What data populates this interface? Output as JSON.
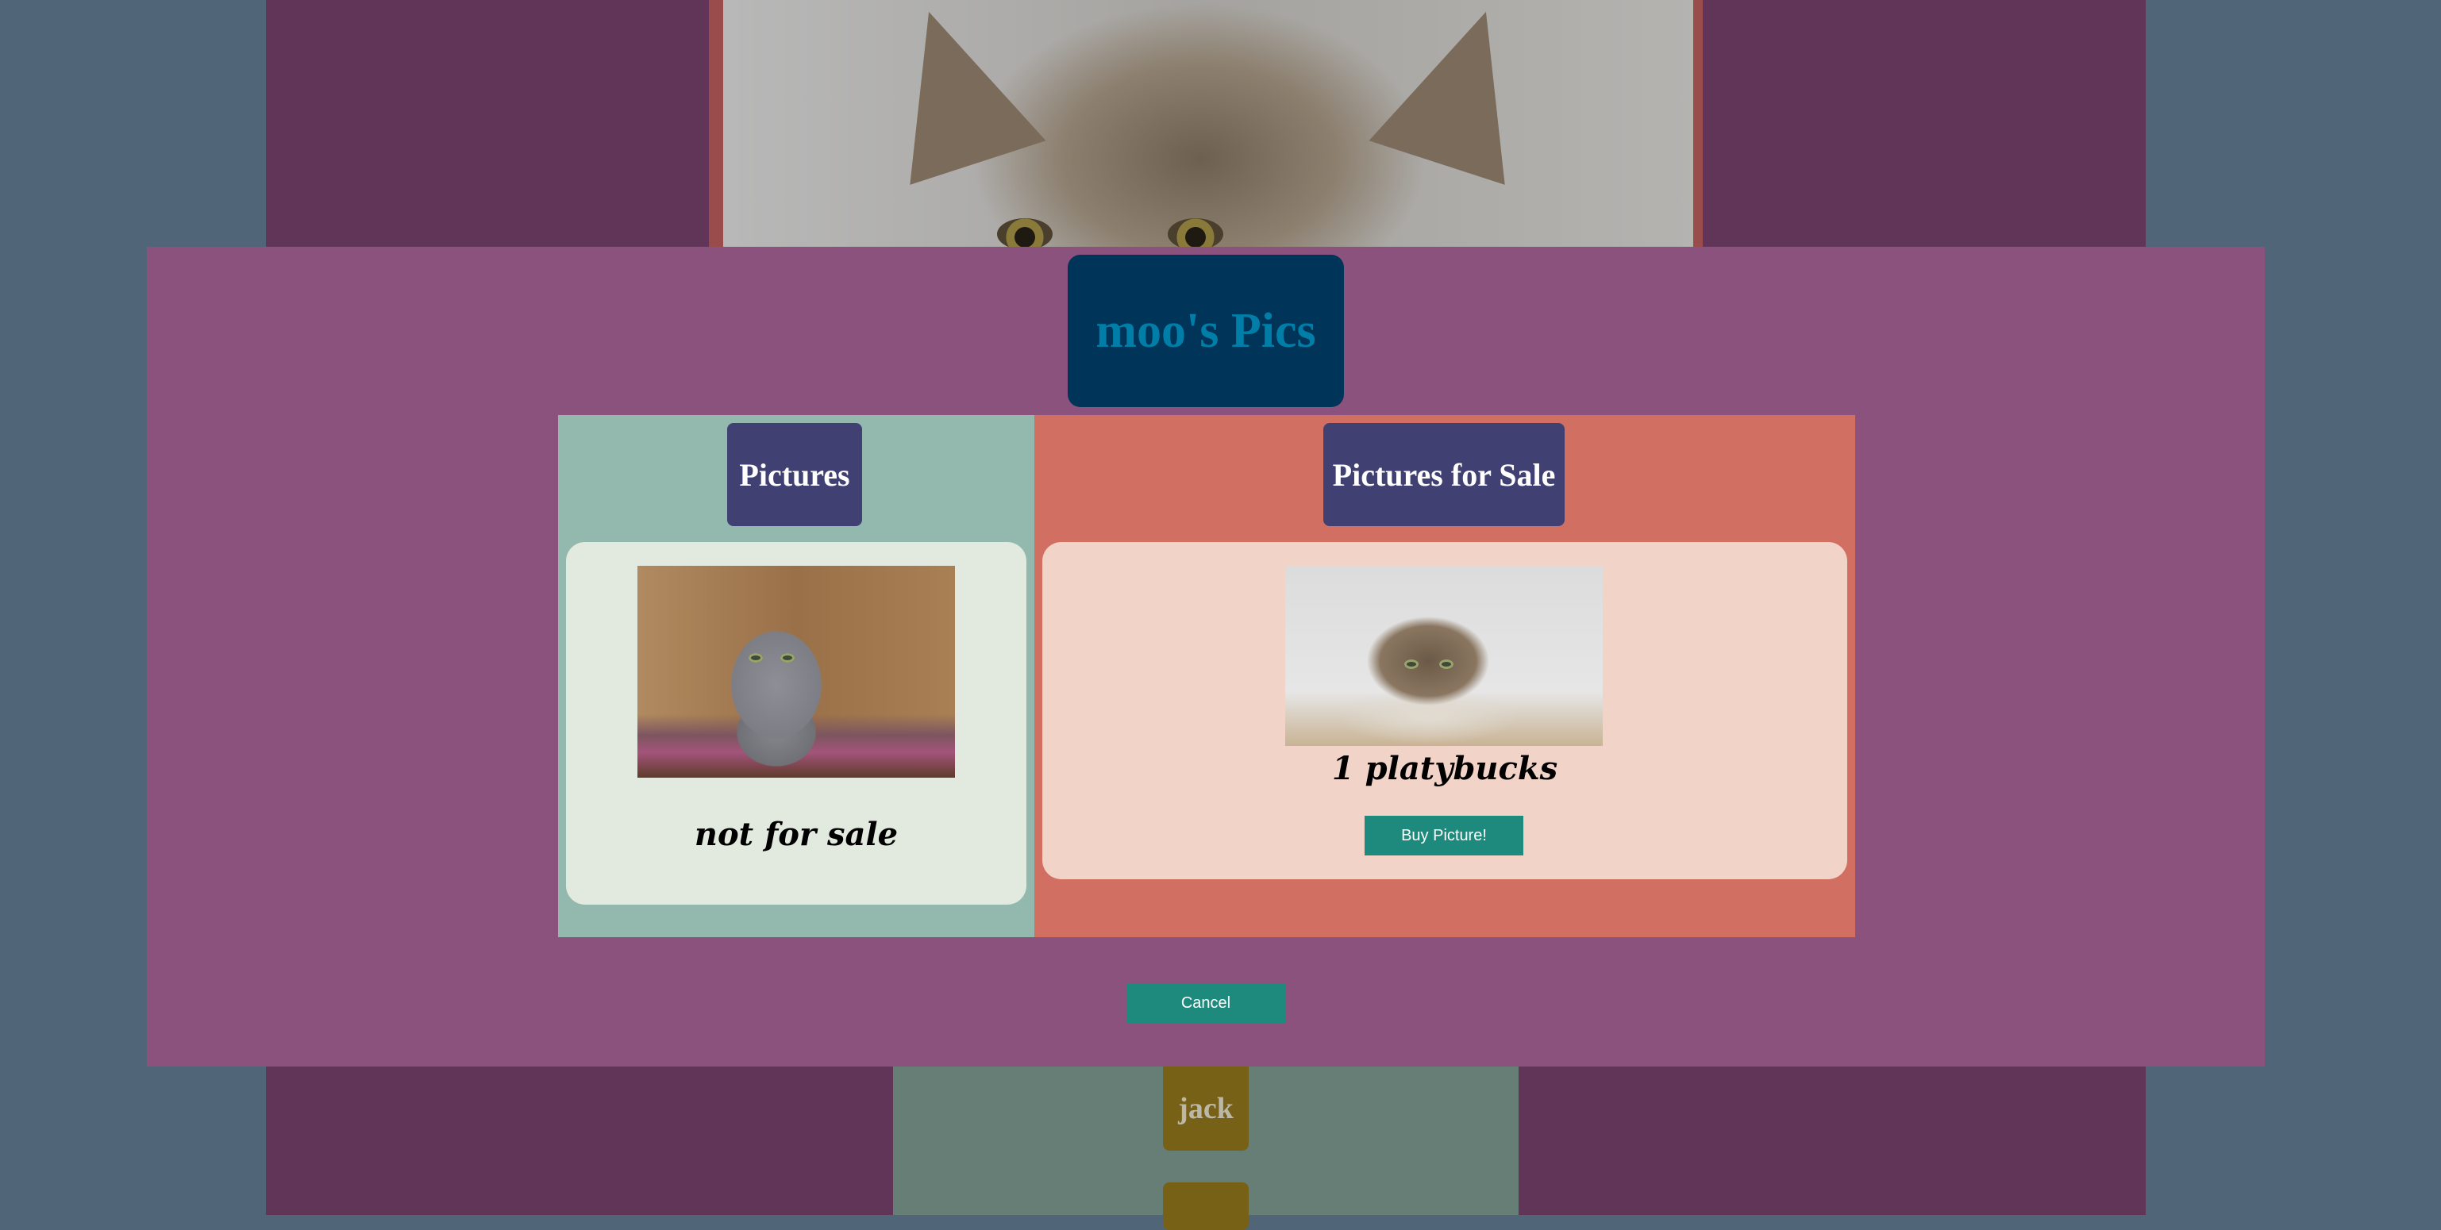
{
  "app": {
    "title": "moo's Pics"
  },
  "background": {
    "name_tag": "jack"
  },
  "pictures": {
    "header": "Pictures",
    "items": [
      {
        "image": "gray-kitten-photo",
        "price_text": "not for sale"
      }
    ]
  },
  "pictures_for_sale": {
    "header": "Pictures for Sale",
    "items": [
      {
        "image": "tabby-cat-photo",
        "price_text": "1 platybucks",
        "buy_label": "Buy Picture!"
      }
    ]
  },
  "footer": {
    "cancel_label": "Cancel"
  },
  "colors": {
    "page_bg": "#506578",
    "modal_bg": "#8b527e",
    "title_bg": "#003459",
    "title_text": "#007ea7",
    "header_bg": "#414073",
    "left_column_bg": "#93b9ae",
    "right_column_bg": "#d17062",
    "button_bg": "#1e8a7e"
  }
}
